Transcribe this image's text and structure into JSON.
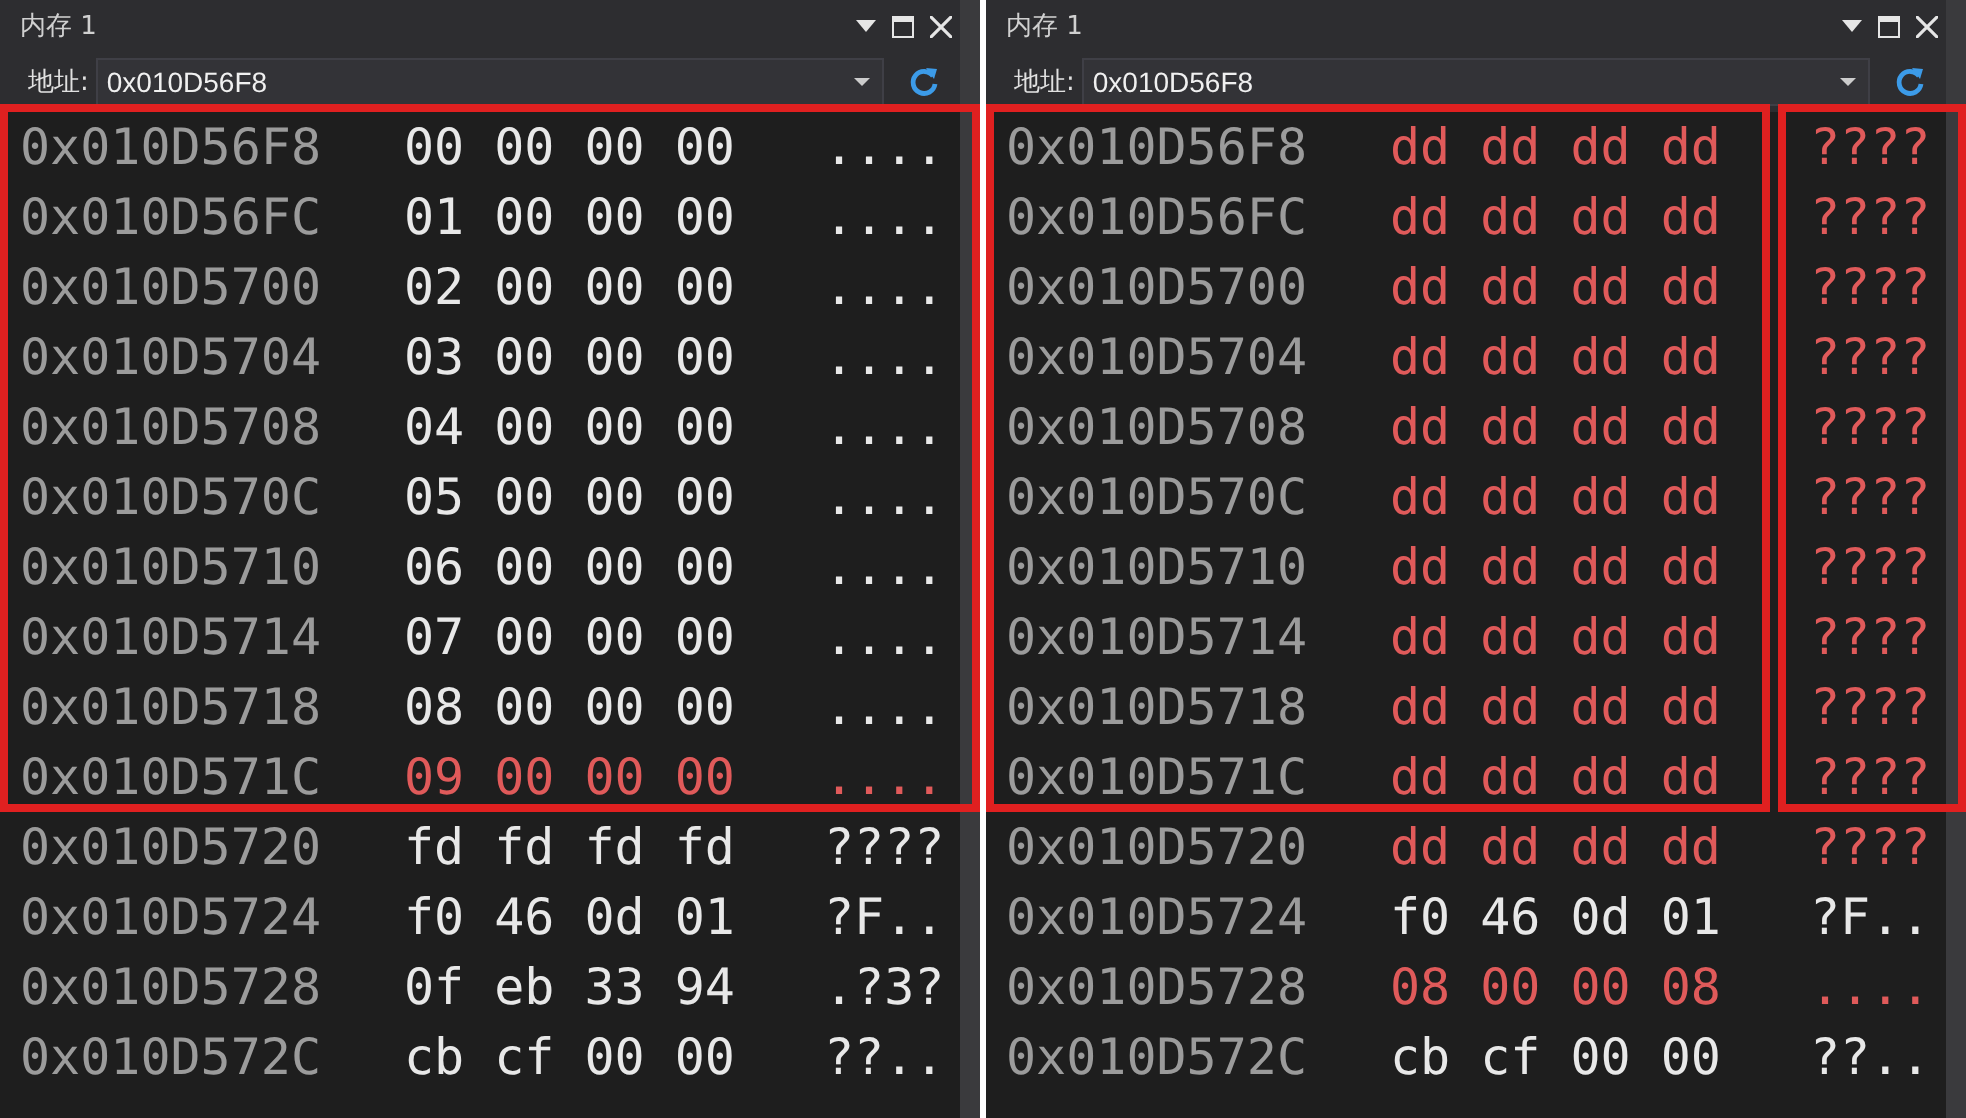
{
  "windows": [
    {
      "title": "内存 1",
      "address_label": "地址:",
      "address_value": "0x010D56F8",
      "ascii_frame_separate": false,
      "rows": [
        {
          "address": "0x010D56F8",
          "bytes": [
            {
              "text": "00",
              "changed": false
            },
            {
              "text": "00",
              "changed": false
            },
            {
              "text": "00",
              "changed": false
            },
            {
              "text": "00",
              "changed": false
            }
          ],
          "ascii": "....",
          "ascii_changed": false,
          "highlighted": true
        },
        {
          "address": "0x010D56FC",
          "bytes": [
            {
              "text": "01",
              "changed": false
            },
            {
              "text": "00",
              "changed": false
            },
            {
              "text": "00",
              "changed": false
            },
            {
              "text": "00",
              "changed": false
            }
          ],
          "ascii": "....",
          "ascii_changed": false,
          "highlighted": true
        },
        {
          "address": "0x010D5700",
          "bytes": [
            {
              "text": "02",
              "changed": false
            },
            {
              "text": "00",
              "changed": false
            },
            {
              "text": "00",
              "changed": false
            },
            {
              "text": "00",
              "changed": false
            }
          ],
          "ascii": "....",
          "ascii_changed": false,
          "highlighted": true
        },
        {
          "address": "0x010D5704",
          "bytes": [
            {
              "text": "03",
              "changed": false
            },
            {
              "text": "00",
              "changed": false
            },
            {
              "text": "00",
              "changed": false
            },
            {
              "text": "00",
              "changed": false
            }
          ],
          "ascii": "....",
          "ascii_changed": false,
          "highlighted": true
        },
        {
          "address": "0x010D5708",
          "bytes": [
            {
              "text": "04",
              "changed": false
            },
            {
              "text": "00",
              "changed": false
            },
            {
              "text": "00",
              "changed": false
            },
            {
              "text": "00",
              "changed": false
            }
          ],
          "ascii": "....",
          "ascii_changed": false,
          "highlighted": true
        },
        {
          "address": "0x010D570C",
          "bytes": [
            {
              "text": "05",
              "changed": false
            },
            {
              "text": "00",
              "changed": false
            },
            {
              "text": "00",
              "changed": false
            },
            {
              "text": "00",
              "changed": false
            }
          ],
          "ascii": "....",
          "ascii_changed": false,
          "highlighted": true
        },
        {
          "address": "0x010D5710",
          "bytes": [
            {
              "text": "06",
              "changed": false
            },
            {
              "text": "00",
              "changed": false
            },
            {
              "text": "00",
              "changed": false
            },
            {
              "text": "00",
              "changed": false
            }
          ],
          "ascii": "....",
          "ascii_changed": false,
          "highlighted": true
        },
        {
          "address": "0x010D5714",
          "bytes": [
            {
              "text": "07",
              "changed": false
            },
            {
              "text": "00",
              "changed": false
            },
            {
              "text": "00",
              "changed": false
            },
            {
              "text": "00",
              "changed": false
            }
          ],
          "ascii": "....",
          "ascii_changed": false,
          "highlighted": true
        },
        {
          "address": "0x010D5718",
          "bytes": [
            {
              "text": "08",
              "changed": false
            },
            {
              "text": "00",
              "changed": false
            },
            {
              "text": "00",
              "changed": false
            },
            {
              "text": "00",
              "changed": false
            }
          ],
          "ascii": "....",
          "ascii_changed": false,
          "highlighted": true
        },
        {
          "address": "0x010D571C",
          "bytes": [
            {
              "text": "09",
              "changed": true
            },
            {
              "text": "00",
              "changed": true
            },
            {
              "text": "00",
              "changed": true
            },
            {
              "text": "00",
              "changed": true
            }
          ],
          "ascii": "....",
          "ascii_changed": true,
          "highlighted": true
        },
        {
          "address": "0x010D5720",
          "bytes": [
            {
              "text": "fd",
              "changed": false
            },
            {
              "text": "fd",
              "changed": false
            },
            {
              "text": "fd",
              "changed": false
            },
            {
              "text": "fd",
              "changed": false
            }
          ],
          "ascii": "????",
          "ascii_changed": false,
          "highlighted": false
        },
        {
          "address": "0x010D5724",
          "bytes": [
            {
              "text": "f0",
              "changed": false
            },
            {
              "text": "46",
              "changed": false
            },
            {
              "text": "0d",
              "changed": false
            },
            {
              "text": "01",
              "changed": false
            }
          ],
          "ascii": "?F..",
          "ascii_changed": false,
          "highlighted": false
        },
        {
          "address": "0x010D5728",
          "bytes": [
            {
              "text": "0f",
              "changed": false
            },
            {
              "text": "eb",
              "changed": false
            },
            {
              "text": "33",
              "changed": false
            },
            {
              "text": "94",
              "changed": false
            }
          ],
          "ascii": ".?3?",
          "ascii_changed": false,
          "highlighted": false
        },
        {
          "address": "0x010D572C",
          "bytes": [
            {
              "text": "cb",
              "changed": false
            },
            {
              "text": "cf",
              "changed": false
            },
            {
              "text": "00",
              "changed": false
            },
            {
              "text": "00",
              "changed": false
            }
          ],
          "ascii": "??..",
          "ascii_changed": false,
          "highlighted": false
        }
      ]
    },
    {
      "title": "内存 1",
      "address_label": "地址:",
      "address_value": "0x010D56F8",
      "ascii_frame_separate": true,
      "rows": [
        {
          "address": "0x010D56F8",
          "bytes": [
            {
              "text": "dd",
              "changed": true
            },
            {
              "text": "dd",
              "changed": true
            },
            {
              "text": "dd",
              "changed": true
            },
            {
              "text": "dd",
              "changed": true
            }
          ],
          "ascii": "????",
          "ascii_changed": true,
          "highlighted": true
        },
        {
          "address": "0x010D56FC",
          "bytes": [
            {
              "text": "dd",
              "changed": true
            },
            {
              "text": "dd",
              "changed": true
            },
            {
              "text": "dd",
              "changed": true
            },
            {
              "text": "dd",
              "changed": true
            }
          ],
          "ascii": "????",
          "ascii_changed": true,
          "highlighted": true
        },
        {
          "address": "0x010D5700",
          "bytes": [
            {
              "text": "dd",
              "changed": true
            },
            {
              "text": "dd",
              "changed": true
            },
            {
              "text": "dd",
              "changed": true
            },
            {
              "text": "dd",
              "changed": true
            }
          ],
          "ascii": "????",
          "ascii_changed": true,
          "highlighted": true
        },
        {
          "address": "0x010D5704",
          "bytes": [
            {
              "text": "dd",
              "changed": true
            },
            {
              "text": "dd",
              "changed": true
            },
            {
              "text": "dd",
              "changed": true
            },
            {
              "text": "dd",
              "changed": true
            }
          ],
          "ascii": "????",
          "ascii_changed": true,
          "highlighted": true
        },
        {
          "address": "0x010D5708",
          "bytes": [
            {
              "text": "dd",
              "changed": true
            },
            {
              "text": "dd",
              "changed": true
            },
            {
              "text": "dd",
              "changed": true
            },
            {
              "text": "dd",
              "changed": true
            }
          ],
          "ascii": "????",
          "ascii_changed": true,
          "highlighted": true
        },
        {
          "address": "0x010D570C",
          "bytes": [
            {
              "text": "dd",
              "changed": true
            },
            {
              "text": "dd",
              "changed": true
            },
            {
              "text": "dd",
              "changed": true
            },
            {
              "text": "dd",
              "changed": true
            }
          ],
          "ascii": "????",
          "ascii_changed": true,
          "highlighted": true
        },
        {
          "address": "0x010D5710",
          "bytes": [
            {
              "text": "dd",
              "changed": true
            },
            {
              "text": "dd",
              "changed": true
            },
            {
              "text": "dd",
              "changed": true
            },
            {
              "text": "dd",
              "changed": true
            }
          ],
          "ascii": "????",
          "ascii_changed": true,
          "highlighted": true
        },
        {
          "address": "0x010D5714",
          "bytes": [
            {
              "text": "dd",
              "changed": true
            },
            {
              "text": "dd",
              "changed": true
            },
            {
              "text": "dd",
              "changed": true
            },
            {
              "text": "dd",
              "changed": true
            }
          ],
          "ascii": "????",
          "ascii_changed": true,
          "highlighted": true
        },
        {
          "address": "0x010D5718",
          "bytes": [
            {
              "text": "dd",
              "changed": true
            },
            {
              "text": "dd",
              "changed": true
            },
            {
              "text": "dd",
              "changed": true
            },
            {
              "text": "dd",
              "changed": true
            }
          ],
          "ascii": "????",
          "ascii_changed": true,
          "highlighted": true
        },
        {
          "address": "0x010D571C",
          "bytes": [
            {
              "text": "dd",
              "changed": true
            },
            {
              "text": "dd",
              "changed": true
            },
            {
              "text": "dd",
              "changed": true
            },
            {
              "text": "dd",
              "changed": true
            }
          ],
          "ascii": "????",
          "ascii_changed": true,
          "highlighted": true
        },
        {
          "address": "0x010D5720",
          "bytes": [
            {
              "text": "dd",
              "changed": true
            },
            {
              "text": "dd",
              "changed": true
            },
            {
              "text": "dd",
              "changed": true
            },
            {
              "text": "dd",
              "changed": true
            }
          ],
          "ascii": "????",
          "ascii_changed": true,
          "highlighted": false
        },
        {
          "address": "0x010D5724",
          "bytes": [
            {
              "text": "f0",
              "changed": false
            },
            {
              "text": "46",
              "changed": false
            },
            {
              "text": "0d",
              "changed": false
            },
            {
              "text": "01",
              "changed": false
            }
          ],
          "ascii": "?F..",
          "ascii_changed": false,
          "highlighted": false
        },
        {
          "address": "0x010D5728",
          "bytes": [
            {
              "text": "08",
              "changed": true
            },
            {
              "text": "00",
              "changed": true
            },
            {
              "text": "00",
              "changed": true
            },
            {
              "text": "08",
              "changed": true
            }
          ],
          "ascii": "....",
          "ascii_changed": true,
          "highlighted": false
        },
        {
          "address": "0x010D572C",
          "bytes": [
            {
              "text": "cb",
              "changed": false
            },
            {
              "text": "cf",
              "changed": false
            },
            {
              "text": "00",
              "changed": false
            },
            {
              "text": "00",
              "changed": false
            }
          ],
          "ascii": "??..",
          "ascii_changed": false,
          "highlighted": false
        }
      ]
    }
  ]
}
